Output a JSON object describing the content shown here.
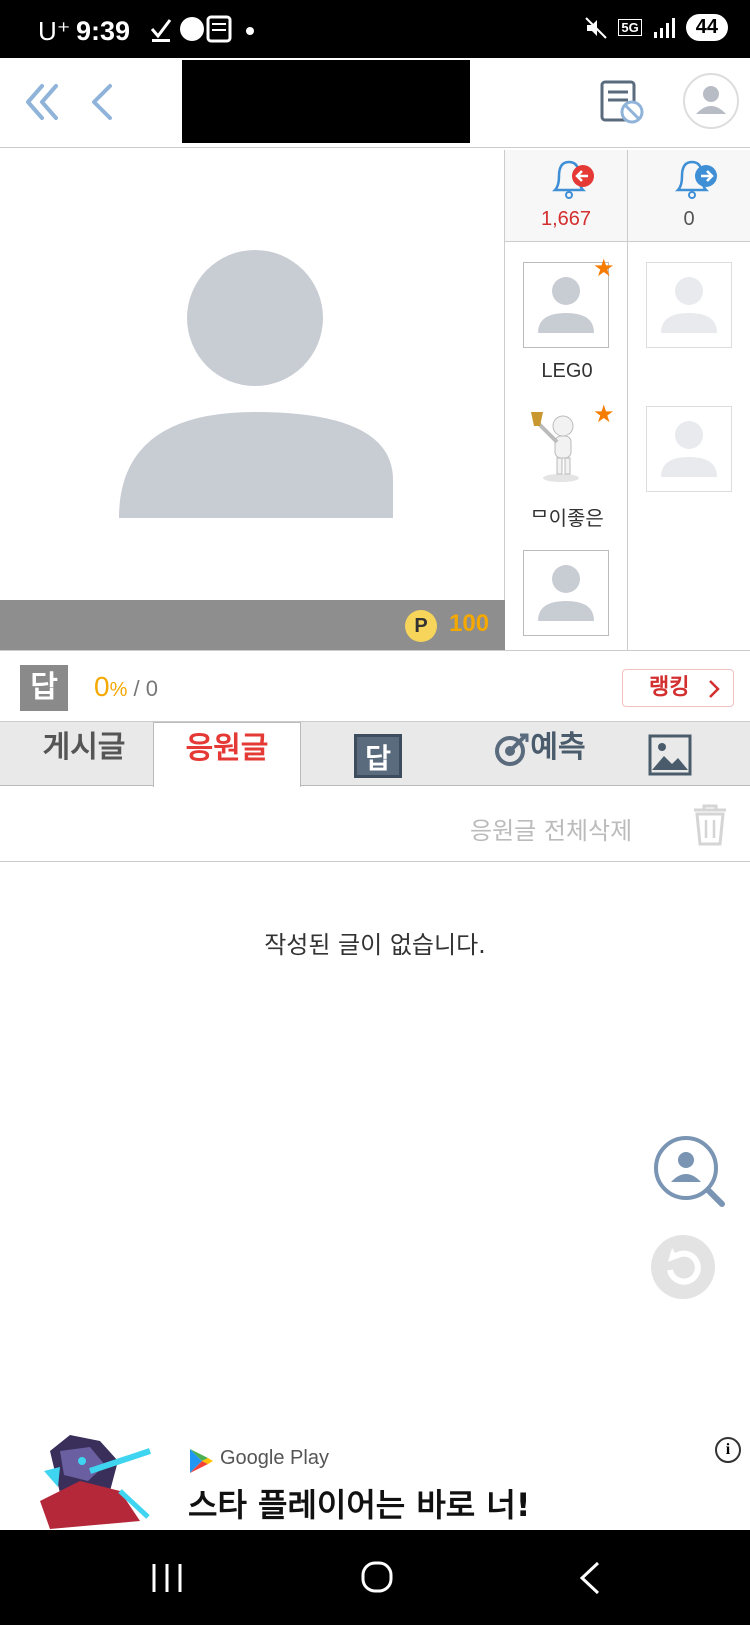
{
  "status_bar": {
    "carrier": "U⁺",
    "time": "9:39",
    "network": "5G",
    "battery": "44"
  },
  "nav": {
    "back_double_icon": "double-chevron-left",
    "back_icon": "chevron-left",
    "block_icon": "block-list-icon",
    "profile_icon": "profile-icon"
  },
  "profile": {
    "points": "100",
    "points_icon": "P"
  },
  "followers": {
    "incoming_count": "1,667",
    "outgoing_count": "0",
    "items": [
      {
        "name": "LEG0",
        "starred": true
      },
      {
        "name": "ᄆ이좋은",
        "starred": true
      },
      {
        "name": "",
        "starred": false
      }
    ]
  },
  "stats": {
    "badge": "답",
    "rate_value": "0",
    "rate_unit": "%",
    "rate_separator": " / ",
    "rate_total": "0",
    "ranking_label": "랭킹"
  },
  "tabs": {
    "posts": "게시글",
    "cheers": "응원글",
    "answer": "답",
    "predict": "예측",
    "photos": "photo"
  },
  "actions": {
    "delete_all": "응원글 전체삭제"
  },
  "content": {
    "empty_message": "작성된 글이 없습니다."
  },
  "ad": {
    "store": "Google Play",
    "headline": "스타 플레이어는 바로 너!",
    "info": "i"
  },
  "colors": {
    "accent_red": "#e53935",
    "points_gold": "#f5a800",
    "nav_blue": "#8fb3d9"
  }
}
